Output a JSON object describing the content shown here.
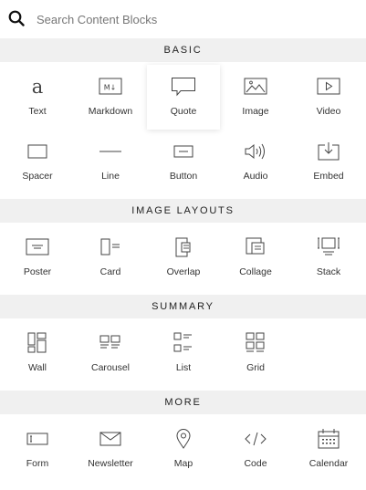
{
  "search": {
    "placeholder": "Search Content Blocks",
    "value": ""
  },
  "sections": {
    "basic": {
      "title": "BASIC",
      "items": [
        {
          "label": "Text",
          "icon": "text-icon"
        },
        {
          "label": "Markdown",
          "icon": "markdown-icon"
        },
        {
          "label": "Quote",
          "icon": "quote-icon",
          "selected": true
        },
        {
          "label": "Image",
          "icon": "image-icon"
        },
        {
          "label": "Video",
          "icon": "video-icon"
        },
        {
          "label": "Spacer",
          "icon": "spacer-icon"
        },
        {
          "label": "Line",
          "icon": "line-icon"
        },
        {
          "label": "Button",
          "icon": "button-icon"
        },
        {
          "label": "Audio",
          "icon": "audio-icon"
        },
        {
          "label": "Embed",
          "icon": "embed-icon"
        }
      ]
    },
    "image_layouts": {
      "title": "IMAGE LAYOUTS",
      "items": [
        {
          "label": "Poster",
          "icon": "poster-icon"
        },
        {
          "label": "Card",
          "icon": "card-icon"
        },
        {
          "label": "Overlap",
          "icon": "overlap-icon"
        },
        {
          "label": "Collage",
          "icon": "collage-icon"
        },
        {
          "label": "Stack",
          "icon": "stack-icon"
        }
      ]
    },
    "summary": {
      "title": "SUMMARY",
      "items": [
        {
          "label": "Wall",
          "icon": "wall-icon"
        },
        {
          "label": "Carousel",
          "icon": "carousel-icon"
        },
        {
          "label": "List",
          "icon": "list-icon"
        },
        {
          "label": "Grid",
          "icon": "grid-icon"
        }
      ]
    },
    "more": {
      "title": "MORE",
      "items": [
        {
          "label": "Form",
          "icon": "form-icon"
        },
        {
          "label": "Newsletter",
          "icon": "newsletter-icon"
        },
        {
          "label": "Map",
          "icon": "map-icon"
        },
        {
          "label": "Code",
          "icon": "code-icon"
        },
        {
          "label": "Calendar",
          "icon": "calendar-icon"
        }
      ]
    }
  }
}
